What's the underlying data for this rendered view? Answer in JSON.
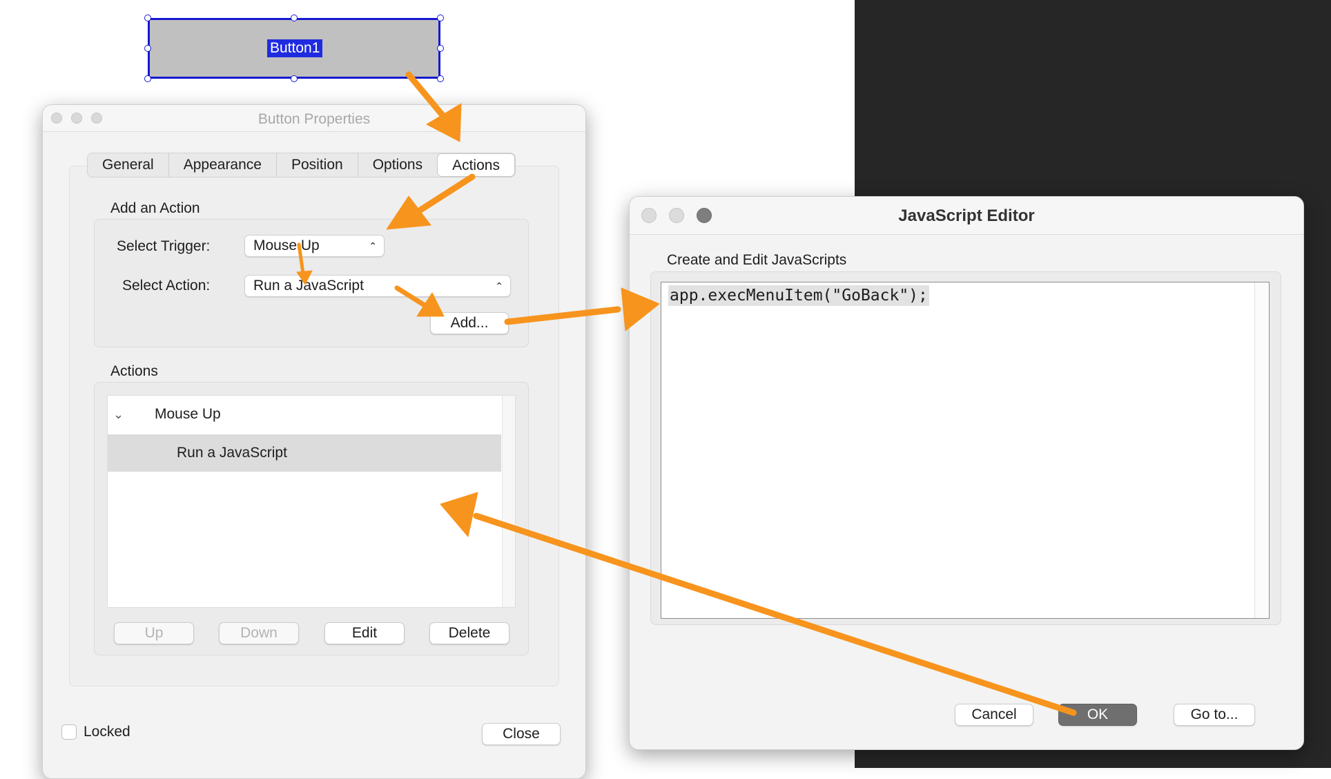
{
  "canvas": {
    "form_button_label": "Button1"
  },
  "properties_window": {
    "title": "Button Properties",
    "tabs": [
      {
        "label": "General"
      },
      {
        "label": "Appearance"
      },
      {
        "label": "Position"
      },
      {
        "label": "Options"
      },
      {
        "label": "Actions"
      }
    ],
    "active_tab": "Actions",
    "add_action": {
      "heading": "Add an Action",
      "trigger_label": "Select Trigger:",
      "trigger_value": "Mouse Up",
      "action_label": "Select Action:",
      "action_value": "Run a JavaScript",
      "add_button": "Add..."
    },
    "actions": {
      "heading": "Actions",
      "tree": [
        {
          "label": "Mouse Up",
          "children": [
            {
              "label": "Run a JavaScript"
            }
          ]
        }
      ],
      "buttons": {
        "up": "Up",
        "down": "Down",
        "edit": "Edit",
        "delete": "Delete"
      }
    },
    "locked_label": "Locked",
    "locked_checked": false,
    "close_button": "Close"
  },
  "js_editor": {
    "title": "JavaScript Editor",
    "subtitle": "Create and Edit JavaScripts",
    "code": "app.execMenuItem(\"GoBack\");",
    "buttons": {
      "cancel": "Cancel",
      "ok": "OK",
      "goto": "Go to..."
    }
  },
  "colors": {
    "annotation_arrow": "#f7941d",
    "selection_blue": "#1518d0",
    "dark_background": "#262626"
  }
}
